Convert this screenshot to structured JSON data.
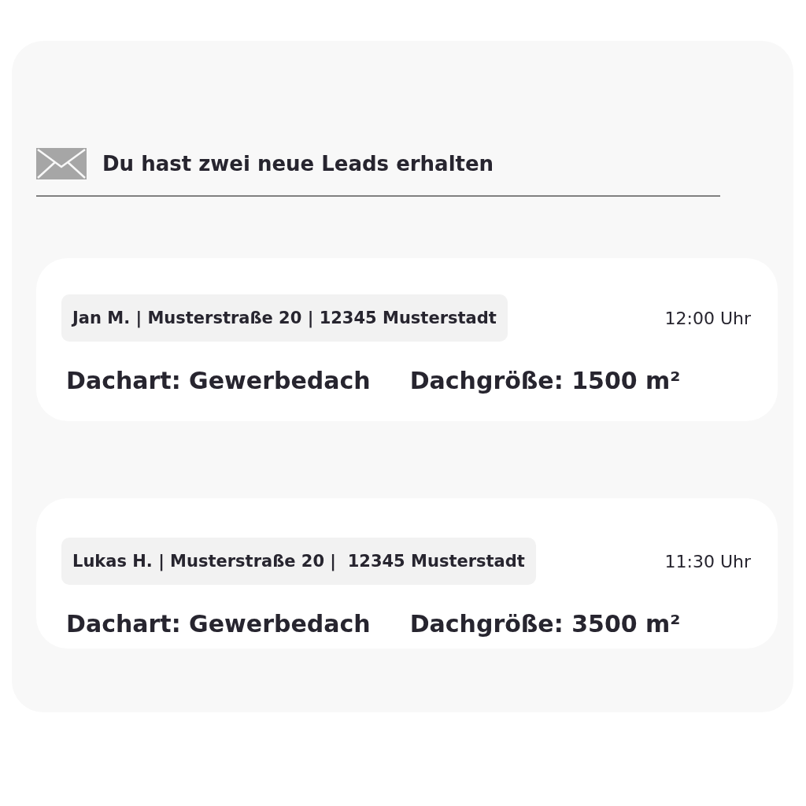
{
  "header": {
    "title": "Du hast zwei neue Leads erhalten"
  },
  "leads": [
    {
      "contact": "Jan M. | Musterstraße 20 | 12345 Musterstadt",
      "time": "12:00 Uhr",
      "roof_type": "Dachart: Gewerbedach",
      "roof_size": "Dachgröße: 1500 m²"
    },
    {
      "contact": "Lukas H. | Musterstraße 20 |  12345 Musterstadt",
      "time": "11:30 Uhr",
      "roof_type": "Dachart: Gewerbedach",
      "roof_size": "Dachgröße: 3500 m²"
    }
  ]
}
